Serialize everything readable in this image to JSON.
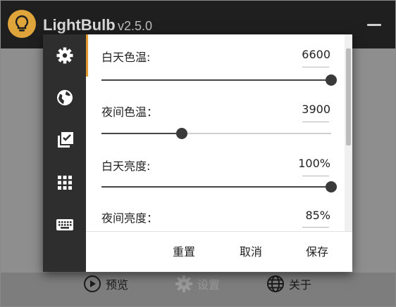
{
  "app": {
    "title": "LightBulb",
    "version": "v2.5.0"
  },
  "settings": [
    {
      "label": "白天色温:",
      "value": "6600",
      "fraction": 1.0
    },
    {
      "label": "夜间色温：",
      "value": "3900",
      "fraction": 0.35
    },
    {
      "label": "白天亮度:",
      "value": "100%",
      "fraction": 1.0
    },
    {
      "label": "夜间亮度：",
      "value": "85%",
      "fraction": 0.85
    }
  ],
  "actions": {
    "reset": "重置",
    "cancel": "取消",
    "save": "保存"
  },
  "bottom_nav": {
    "preview": "预览",
    "settings": "设置",
    "about": "关于"
  },
  "rail_icons": [
    "gear-icon",
    "globe-icon",
    "checklist-icon",
    "grid-icon",
    "keyboard-icon"
  ],
  "colors": {
    "accent": "#e39a2e",
    "logo": "#e0a53a"
  }
}
